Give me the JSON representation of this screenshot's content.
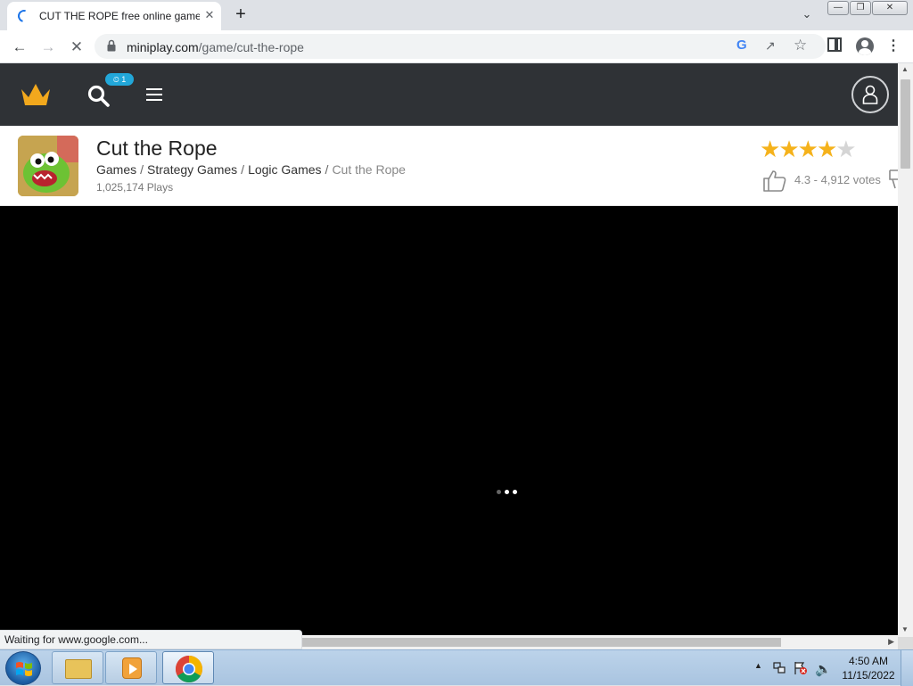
{
  "browser": {
    "tab_title": "CUT THE ROPE free online game",
    "url_host": "miniplay.com",
    "url_path": "/game/cut-the-rope"
  },
  "site_header": {
    "badge_text": "⏲ 1"
  },
  "game": {
    "title": "Cut the Rope",
    "breadcrumbs": [
      "Games",
      "Strategy Games",
      "Logic Games",
      "Cut the Rope"
    ],
    "plays": "1,025,174 Plays",
    "rating": 4.3,
    "votes_text": "4.3 - 4,912 votes",
    "star_color": "#f5b21b"
  },
  "status_bar": {
    "text": "Waiting for www.google.com..."
  },
  "taskbar": {
    "time": "4:50 AM",
    "date": "11/15/2022"
  }
}
